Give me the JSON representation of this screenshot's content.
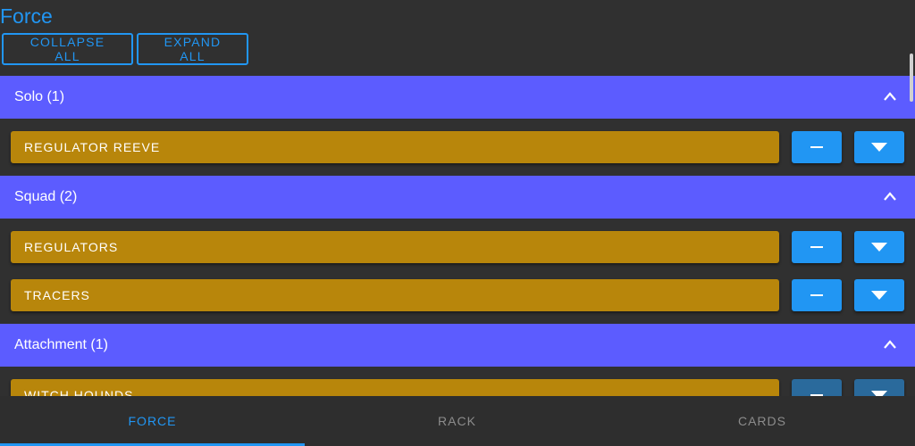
{
  "page": {
    "title": "Force"
  },
  "toolbar": {
    "collapse_label": "COLLAPSE ALL",
    "expand_label": "EXPAND ALL"
  },
  "sections": [
    {
      "title": "Solo (1)",
      "units": [
        "REGULATOR REEVE"
      ]
    },
    {
      "title": "Squad (2)",
      "units": [
        "REGULATORS",
        "TRACERS"
      ]
    },
    {
      "title": "Attachment (1)",
      "units": [
        "WITCH HOUNDS"
      ]
    }
  ],
  "icons": {
    "chevron": "chevron-up-icon",
    "minus": "minus-icon",
    "expand": "caret-down-icon"
  },
  "colors": {
    "accent": "#2196f3",
    "section": "#5c5cff",
    "unit": "#b8860b",
    "background": "#303030"
  },
  "nav": {
    "tabs": [
      "FORCE",
      "RACK",
      "CARDS"
    ],
    "active": "FORCE"
  }
}
